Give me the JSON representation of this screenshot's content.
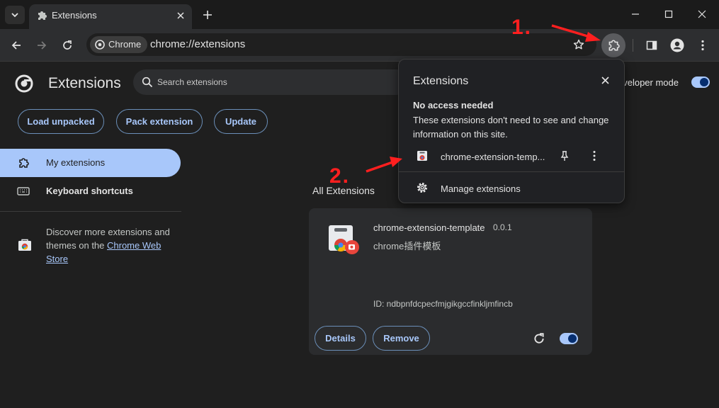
{
  "browser": {
    "tab": {
      "title": "Extensions"
    },
    "chip_label": "Chrome",
    "url": "chrome://extensions"
  },
  "page": {
    "title": "Extensions",
    "search_placeholder": "Search extensions",
    "developer_mode_label": "eveloper mode",
    "developer_mode_on": true,
    "buttons": {
      "load_unpacked": "Load unpacked",
      "pack_extension": "Pack extension",
      "update": "Update"
    }
  },
  "sidebar": {
    "items": [
      {
        "label": "My extensions",
        "icon": "puzzle-icon",
        "active": true
      },
      {
        "label": "Keyboard shortcuts",
        "icon": "keyboard-icon",
        "active": false
      }
    ],
    "discover": {
      "text": "Discover more extensions and themes on the ",
      "link": "Chrome Web Store"
    }
  },
  "main": {
    "section_title": "All Extensions",
    "extension": {
      "name": "chrome-extension-template",
      "version": "0.0.1",
      "description": "chrome插件模板",
      "id_text": "ID: ndbpnfdcpecfmjgikgccfinkljmfincb",
      "details_label": "Details",
      "remove_label": "Remove",
      "enabled": true
    }
  },
  "popup": {
    "title": "Extensions",
    "heading": "No access needed",
    "description": "These extensions don't need to see and change information on this site.",
    "ext_name": "chrome-extension-temp...",
    "manage_label": "Manage extensions"
  },
  "annotations": {
    "step1": "1.",
    "step2": "2.",
    "color": "#ff1f1f"
  },
  "colors": {
    "accent": "#a8c7fa",
    "background": "#1f1f1f",
    "surface": "#2d2e30"
  }
}
